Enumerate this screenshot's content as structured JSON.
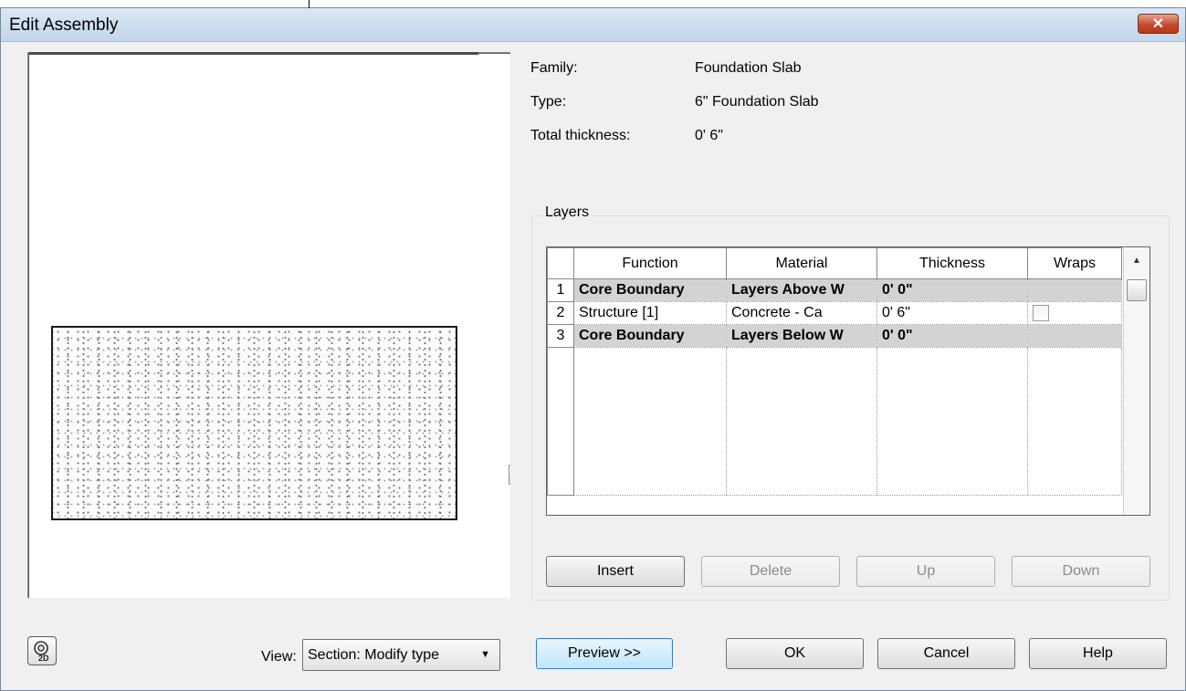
{
  "window": {
    "title": "Edit Assembly",
    "close_glyph": "✕"
  },
  "properties": {
    "family_label": "Family:",
    "family_value": "Foundation Slab",
    "type_label": "Type:",
    "type_value": "6\" Foundation Slab",
    "thickness_label": "Total thickness:",
    "thickness_value": "0'  6\""
  },
  "layers": {
    "group_label": "Layers",
    "columns": [
      "Function",
      "Material",
      "Thickness",
      "Wraps"
    ],
    "rows": [
      {
        "num": "1",
        "function": "Core Boundary",
        "material": "Layers Above W",
        "thickness": "0'  0\"",
        "wraps": ""
      },
      {
        "num": "2",
        "function": "Structure [1]",
        "material": "Concrete - Ca",
        "thickness": "0'  6\"",
        "wraps": "checkbox"
      },
      {
        "num": "3",
        "function": "Core Boundary",
        "material": "Layers Below W",
        "thickness": "0'  0\"",
        "wraps": ""
      }
    ]
  },
  "buttons": {
    "insert": "Insert",
    "delete": "Delete",
    "up": "Up",
    "down": "Down",
    "preview": "Preview >>",
    "ok": "OK",
    "cancel": "Cancel",
    "help": "Help"
  },
  "view": {
    "label": "View:",
    "selected": "Section: Modify type"
  },
  "icons": {
    "toggle_2d": "view-2d-icon",
    "preview_scroll_up": "scroll-up-arrow-icon",
    "grid_scroll_up": "scroll-up-arrow-icon",
    "dropdown": "chevron-down-icon"
  },
  "colors": {
    "core_row_bg": "#d3d3d3",
    "close_button": "#c74a2d",
    "default_button": "#bee6fd"
  }
}
